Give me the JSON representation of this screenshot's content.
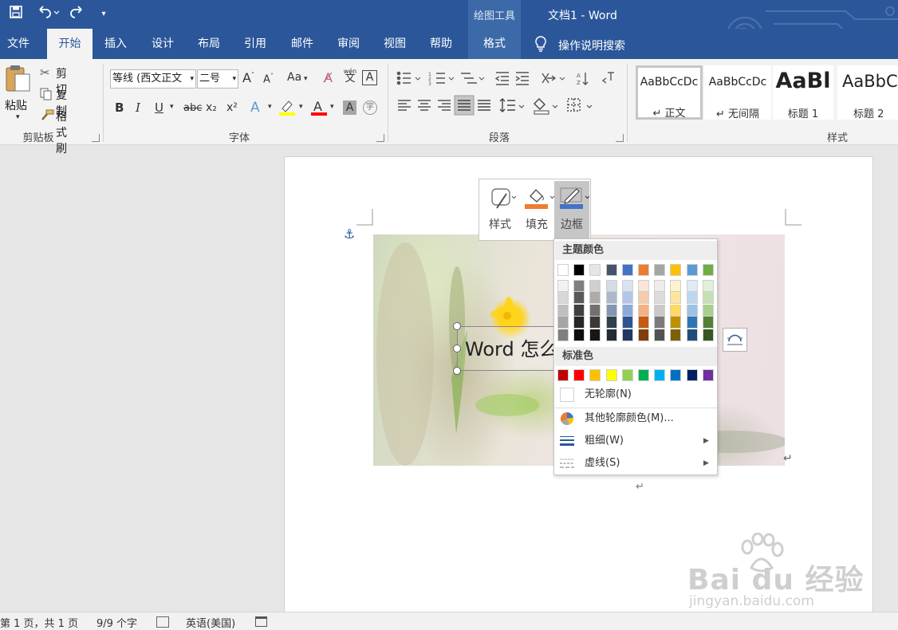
{
  "window": {
    "title": "文档1  -  Word",
    "context_group": "绘图工具"
  },
  "tabs": {
    "file": "文件",
    "home": "开始",
    "insert": "插入",
    "design": "设计",
    "layout": "布局",
    "references": "引用",
    "mailings": "邮件",
    "review": "审阅",
    "view": "视图",
    "help": "帮助",
    "format": "格式",
    "tell_me": "操作说明搜索"
  },
  "ribbon": {
    "clipboard": {
      "label": "剪贴板",
      "paste": "粘贴",
      "cut": "剪切",
      "copy": "复制",
      "format_painter": "格式刷"
    },
    "font": {
      "label": "字体",
      "font_name": "等线 (西文正文",
      "font_size": "二号",
      "bold": "B",
      "italic": "I",
      "underline": "U",
      "strike": "abc",
      "subscript": "x₂",
      "superscript": "x²",
      "change_case": "Aa",
      "phonetic": "wén",
      "phonetic_char": "文"
    },
    "paragraph": {
      "label": "段落"
    },
    "styles": {
      "label": "样式",
      "items": [
        {
          "preview": "AaBbCcDc",
          "name": "↵ 正文"
        },
        {
          "preview": "AaBbCcDc",
          "name": "↵ 无间隔"
        },
        {
          "preview": "AaBl",
          "name": "标题 1"
        },
        {
          "preview": "AaBbC",
          "name": "标题 2"
        }
      ]
    }
  },
  "document": {
    "textbox_text": "Word 怎么",
    "paragraph_mark": "↵"
  },
  "mini_toolbar": {
    "style": "样式",
    "fill": "填充",
    "border": "边框"
  },
  "outline_menu": {
    "theme_colors_header": "主题颜色",
    "standard_colors_header": "标准色",
    "no_outline": "无轮廓(N)",
    "more_colors": "其他轮廓颜色(M)...",
    "weight": "粗细(W)",
    "dashes": "虚线(S)",
    "theme_top_row": [
      "#ffffff",
      "#000000",
      "#e7e6e6",
      "#44546a",
      "#4472c4",
      "#ed7d31",
      "#a5a5a5",
      "#ffc000",
      "#5b9bd5",
      "#70ad47"
    ],
    "theme_shades": [
      [
        "#f2f2f2",
        "#7f7f7f",
        "#d0cece",
        "#d6dce4",
        "#d9e2f3",
        "#fbe5d5",
        "#ededed",
        "#fff2cc",
        "#deebf6",
        "#e2efd9"
      ],
      [
        "#d8d8d8",
        "#595959",
        "#aeabab",
        "#adb9ca",
        "#b4c6e7",
        "#f7cbac",
        "#dbdbdb",
        "#fee599",
        "#bdd7ee",
        "#c5e0b3"
      ],
      [
        "#bfbfbf",
        "#3f3f3f",
        "#757070",
        "#8496b0",
        "#8eaadb",
        "#f4b183",
        "#c9c9c9",
        "#ffd965",
        "#9cc3e5",
        "#a8d08d"
      ],
      [
        "#a5a5a5",
        "#262626",
        "#3a3838",
        "#323f4f",
        "#2f5496",
        "#c55a11",
        "#7b7b7b",
        "#bf9000",
        "#2e75b5",
        "#538135"
      ],
      [
        "#7f7f7f",
        "#0c0c0c",
        "#171616",
        "#222a35",
        "#1f3864",
        "#833c0b",
        "#525252",
        "#7f6000",
        "#1e4e79",
        "#375623"
      ]
    ],
    "standard": [
      "#c00000",
      "#ff0000",
      "#ffc000",
      "#ffff00",
      "#92d050",
      "#00b050",
      "#00b0f0",
      "#0070c0",
      "#002060",
      "#7030a0"
    ]
  },
  "statusbar": {
    "page": "第 1 页，共 1 页",
    "words": "9/9 个字",
    "language": "英语(美国)"
  },
  "watermark": {
    "logo": "Bai du 经验",
    "url": "jingyan.baidu.com"
  },
  "colors": {
    "title_blue": "#2b579a",
    "context_blue": "#3c6aa8",
    "fill_accent": "#ed7d31",
    "border_accent": "#4472c4"
  }
}
